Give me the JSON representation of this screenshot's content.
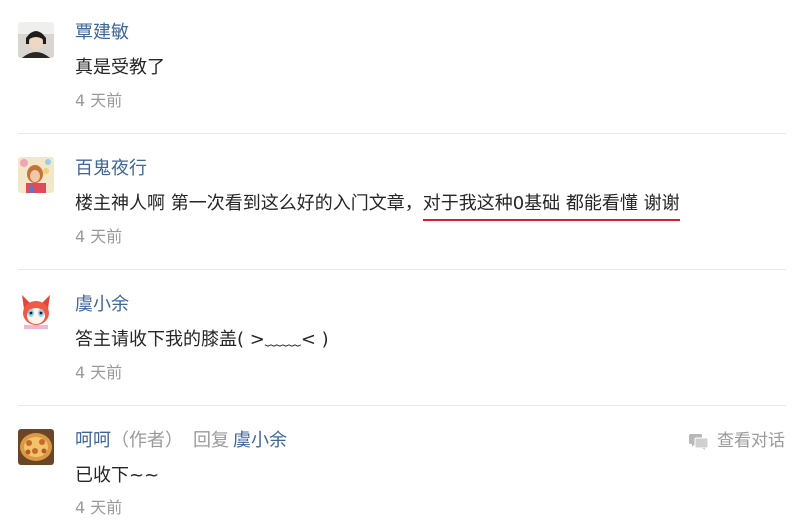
{
  "comments": [
    {
      "author": "覃建敏",
      "text": "真是受教了",
      "time": "4 天前"
    },
    {
      "author": "百鬼夜行",
      "text_plain": "楼主神人啊 第一次看到这么好的入门文章，",
      "text_underlined": "对于我这种0基础 都能看懂 谢谢",
      "time": "4 天前"
    },
    {
      "author": "虞小余",
      "text": "答主请收下我的膝盖( >﹏﹏< )",
      "time": "4 天前"
    },
    {
      "author": "呵呵",
      "author_tag": "（作者）",
      "reply_word": "回复",
      "reply_to": "虞小余",
      "view_dialog": "查看对话",
      "text": "已收下~~",
      "time": "4 天前"
    }
  ],
  "icons": {
    "dialog_icon": "chat-bubbles-icon"
  },
  "colors": {
    "author_link": "#406599",
    "body_text": "#262626",
    "meta_text": "#9a9a9a",
    "highlight_underline": "#d81e2a",
    "divider": "#e8e8e8"
  }
}
